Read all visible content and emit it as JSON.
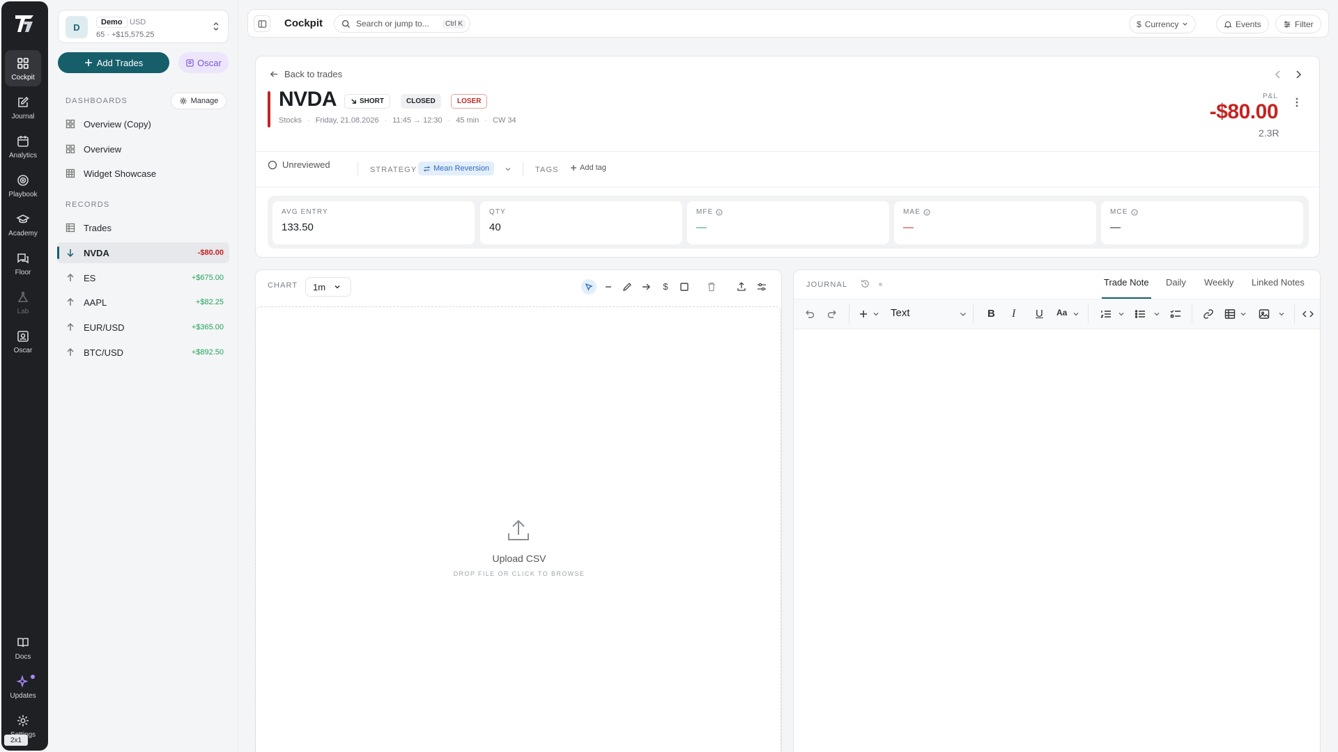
{
  "rail": {
    "items": [
      {
        "label": "Cockpit",
        "icon": "grid-icon"
      },
      {
        "label": "Journal",
        "icon": "edit-icon"
      },
      {
        "label": "Analytics",
        "icon": "calendar-icon"
      },
      {
        "label": "Playbook",
        "icon": "target-icon"
      },
      {
        "label": "Academy",
        "icon": "graduation-cap-icon"
      },
      {
        "label": "Floor",
        "icon": "chat-icon"
      },
      {
        "label": "Lab",
        "icon": "flask-icon"
      },
      {
        "label": "Oscar",
        "icon": "oscar-icon"
      }
    ],
    "bottom": [
      {
        "label": "Docs",
        "icon": "book-icon"
      },
      {
        "label": "Updates",
        "icon": "sparkle-icon"
      },
      {
        "label": "Settings",
        "icon": "gear-icon"
      }
    ],
    "badge": "2x1"
  },
  "account": {
    "initial": "D",
    "name": "Demo",
    "currency": "USD",
    "summary": "65 · +$15,575.25"
  },
  "sidebar": {
    "add_trades": "Add Trades",
    "oscar": "Oscar",
    "dashboards_label": "DASHBOARDS",
    "manage": "Manage",
    "dashboards": [
      "Overview (Copy)",
      "Overview",
      "Widget Showcase"
    ],
    "records_label": "RECORDS",
    "trades": "Trades",
    "records": [
      {
        "symbol": "NVDA",
        "pnl": "-$80.00",
        "dir": "down"
      },
      {
        "symbol": "ES",
        "pnl": "+$675.00",
        "dir": "up"
      },
      {
        "symbol": "AAPL",
        "pnl": "+$82.25",
        "dir": "up"
      },
      {
        "symbol": "EUR/USD",
        "pnl": "+$365.00",
        "dir": "up"
      },
      {
        "symbol": "BTC/USD",
        "pnl": "+$892.50",
        "dir": "up"
      }
    ]
  },
  "topbar": {
    "title": "Cockpit",
    "search_placeholder": "Search or jump to...",
    "shortcut": "Ctrl K",
    "currency": "Currency",
    "events": "Events",
    "filter": "Filter"
  },
  "trade": {
    "back": "Back to trades",
    "symbol": "NVDA",
    "side": "SHORT",
    "status": "CLOSED",
    "result": "LOSER",
    "asset_class": "Stocks",
    "date": "Friday, 21.08.2026",
    "time": "11:45 → 12:30",
    "duration": "45 min",
    "week": "CW 34",
    "pnl_label": "P&L",
    "pnl": "-$80.00",
    "r_multiple": "2.3R",
    "review": "Unreviewed",
    "strategy_label": "STRATEGY",
    "strategy": "Mean Reversion",
    "tags_label": "TAGS",
    "add_tag": "Add tag",
    "stats": [
      {
        "label": "AVG ENTRY",
        "value": "133.50"
      },
      {
        "label": "QTY",
        "value": "40"
      },
      {
        "label": "MFE",
        "value": "—",
        "color": "#21a35c"
      },
      {
        "label": "MAE",
        "value": "—",
        "color": "#c42424"
      },
      {
        "label": "MCE",
        "value": "—"
      }
    ]
  },
  "chart": {
    "label": "CHART",
    "timeframe": "1m",
    "upload_title": "Upload CSV",
    "upload_sub": "DROP FILE OR CLICK TO BROWSE"
  },
  "journal": {
    "label": "JOURNAL",
    "tabs": [
      "Trade Note",
      "Daily",
      "Weekly",
      "Linked Notes"
    ],
    "block_type": "Text"
  }
}
